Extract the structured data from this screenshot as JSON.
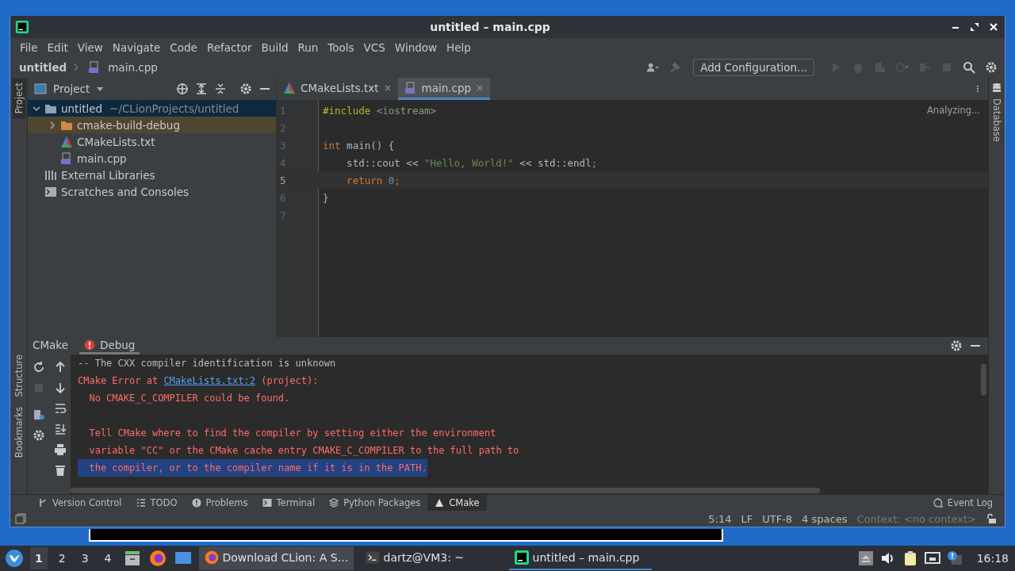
{
  "window": {
    "title": "untitled – main.cpp"
  },
  "menu": [
    "File",
    "Edit",
    "View",
    "Navigate",
    "Code",
    "Refactor",
    "Build",
    "Run",
    "Tools",
    "VCS",
    "Window",
    "Help"
  ],
  "breadcrumb": [
    "untitled",
    "main.cpp"
  ],
  "toolbar": {
    "config_button": "Add Configuration..."
  },
  "left_stripe_top": [
    {
      "label": "Project",
      "selected": true
    }
  ],
  "left_stripe_bottom": [
    {
      "label": "Structure",
      "selected": false
    },
    {
      "label": "Bookmarks",
      "selected": false
    }
  ],
  "right_stripe": [
    {
      "label": "Database",
      "selected": false
    }
  ],
  "project_panel": {
    "title": "Project",
    "tree": [
      {
        "label": "untitled",
        "hint": "~/CLionProjects/untitled",
        "kind": "folder",
        "expanded": true,
        "selected": true,
        "children": [
          {
            "label": "cmake-build-debug",
            "kind": "excluded_folder",
            "expanded": false,
            "selected": false
          },
          {
            "label": "CMakeLists.txt",
            "kind": "cmake",
            "selected": false
          },
          {
            "label": "main.cpp",
            "kind": "cpp",
            "selected": false
          }
        ]
      },
      {
        "label": "External Libraries",
        "kind": "libraries",
        "selected": false
      },
      {
        "label": "Scratches and Consoles",
        "kind": "scratches",
        "selected": false
      }
    ]
  },
  "editor": {
    "tabs": [
      {
        "label": "CMakeLists.txt",
        "kind": "cmake",
        "selected": false
      },
      {
        "label": "main.cpp",
        "kind": "cpp",
        "selected": true
      }
    ],
    "status": "Analyzing...",
    "lines": [
      {
        "number": "1",
        "current": false,
        "tokens": [
          {
            "text": "#include",
            "kind": "directive"
          },
          {
            "text": " <iostream>",
            "kind": "header"
          }
        ]
      },
      {
        "number": "2",
        "current": false
      },
      {
        "number": "3",
        "current": false,
        "tokens": [
          {
            "text": "int",
            "kind": "keyword"
          },
          {
            "text": " main() {",
            "kind": "plain"
          }
        ]
      },
      {
        "number": "4",
        "current": false,
        "tokens": [
          {
            "text": "    std::cout << ",
            "kind": "plain"
          },
          {
            "text": "\"Hello, World!\"",
            "kind": "string"
          },
          {
            "text": " << std::endl",
            "kind": "plain"
          },
          {
            "text": ";",
            "kind": "keyword"
          }
        ]
      },
      {
        "number": "5",
        "current": true,
        "tokens": [
          {
            "text": "    return",
            "kind": "keyword"
          },
          {
            "text": " 0",
            "kind": "number"
          },
          {
            "text": ";",
            "kind": "keyword"
          }
        ]
      },
      {
        "number": "6",
        "current": false,
        "tokens": [
          {
            "text": "}",
            "kind": "plain"
          }
        ]
      },
      {
        "number": "7",
        "current": false
      }
    ]
  },
  "tool_window": {
    "tabs": [
      {
        "label": "CMake",
        "selected": false,
        "error": false
      },
      {
        "label": "Debug",
        "selected": true,
        "error": true
      }
    ],
    "console": [
      {
        "kind": "info",
        "selected": false,
        "parts": [
          {
            "text": "-- The CXX compiler identification is unknown",
            "kind": "text"
          }
        ]
      },
      {
        "kind": "error",
        "selected": false,
        "parts": [
          {
            "text": "CMake Error at ",
            "kind": "text"
          },
          {
            "text": "CMakeLists.txt:2",
            "kind": "link"
          },
          {
            "text": " (project):",
            "kind": "text"
          }
        ]
      },
      {
        "kind": "error",
        "selected": false,
        "parts": [
          {
            "text": "  No CMAKE_C_COMPILER could be found.",
            "kind": "text"
          }
        ]
      },
      {
        "kind": "blank",
        "selected": false
      },
      {
        "kind": "error",
        "selected": false,
        "parts": [
          {
            "text": "  Tell CMake where to find the compiler by setting either the environment",
            "kind": "text"
          }
        ]
      },
      {
        "kind": "error",
        "selected": false,
        "parts": [
          {
            "text": "  variable \"CC\" or the CMake cache entry CMAKE_C_COMPILER to the full path to",
            "kind": "text"
          }
        ]
      },
      {
        "kind": "error",
        "selected": true,
        "parts": [
          {
            "text": "  the compiler, or to the compiler name if it is in the PATH.",
            "kind": "text"
          }
        ]
      }
    ]
  },
  "bottom_bar": [
    {
      "label": "Version Control",
      "kind": "branch",
      "selected": false
    },
    {
      "label": "TODO",
      "kind": "list",
      "selected": false
    },
    {
      "label": "Problems",
      "kind": "alert",
      "selected": false
    },
    {
      "label": "Terminal",
      "kind": "terminal",
      "selected": false
    },
    {
      "label": "Python Packages",
      "kind": "layers",
      "selected": false
    },
    {
      "label": "CMake",
      "kind": "triangle",
      "selected": true
    }
  ],
  "event_log": "Event Log",
  "status_bar": [
    "5:14",
    "LF",
    "UTF-8",
    "4 spaces"
  ],
  "context": "Context: <no context>",
  "taskbar": {
    "workspaces": [
      {
        "label": "1",
        "selected": true
      },
      {
        "label": "2",
        "selected": false
      },
      {
        "label": "3",
        "selected": false
      },
      {
        "label": "4",
        "selected": false
      }
    ],
    "tasks": [
      {
        "label": "Download CLion: A S…",
        "kind": "firefox",
        "selected": false
      },
      {
        "label": "dartz@VM3: ~",
        "kind": "terminal",
        "selected": false
      },
      {
        "label": "untitled – main.cpp",
        "kind": "clion",
        "selected": true
      }
    ],
    "clock": "16:18"
  }
}
